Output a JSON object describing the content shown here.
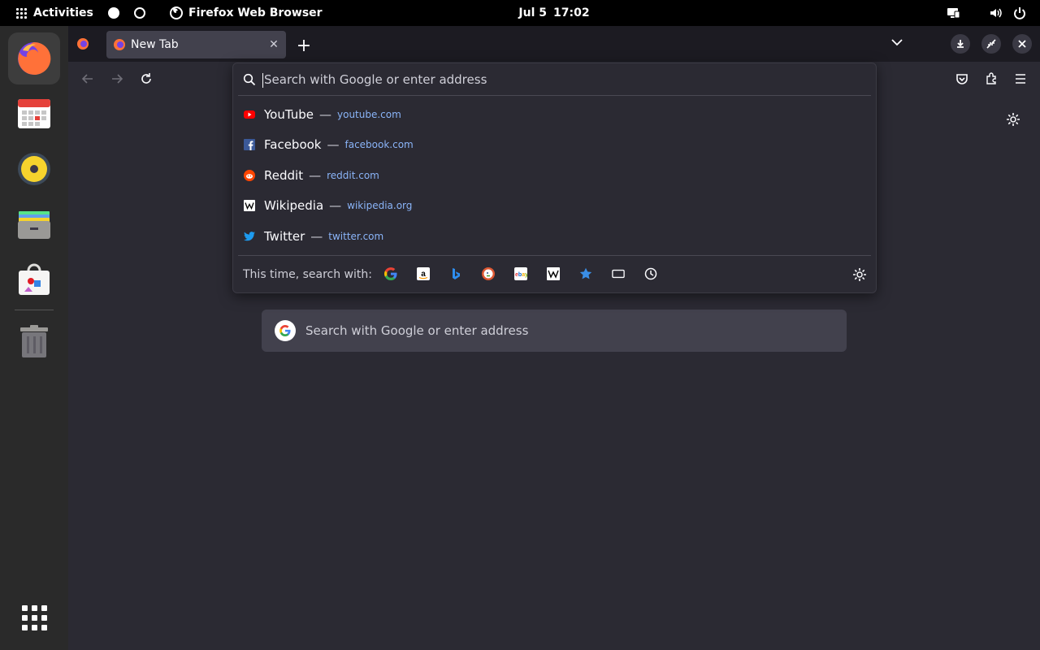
{
  "topbar": {
    "activities": "Activities",
    "app_name": "Firefox Web Browser",
    "date": "Jul 5",
    "time": "17:02"
  },
  "dock": {
    "items": [
      "Firefox",
      "Calendar",
      "Rhythmbox",
      "Files",
      "Software",
      "Trash",
      "Show Applications"
    ]
  },
  "tabs": {
    "active_title": "New Tab",
    "close": "✕",
    "new_tab": "+"
  },
  "urlbar": {
    "placeholder": "Search with Google or enter address",
    "suggestions": [
      {
        "title": "YouTube",
        "url": "youtube.com"
      },
      {
        "title": "Facebook",
        "url": "facebook.com"
      },
      {
        "title": "Reddit",
        "url": "reddit.com"
      },
      {
        "title": "Wikipedia",
        "url": "wikipedia.org"
      },
      {
        "title": "Twitter",
        "url": "twitter.com"
      }
    ],
    "separator": "—",
    "oneoff_label": "This time, search with:",
    "engines": [
      "Google",
      "Amazon",
      "Bing",
      "DuckDuckGo",
      "eBay",
      "Wikipedia",
      "Bookmarks",
      "Tabs",
      "History"
    ]
  },
  "newtab": {
    "search_placeholder": "Search with Google or enter address"
  },
  "colors": {
    "accent": "#8ab4f8",
    "chrome_bg": "#1c1b22",
    "toolbar_bg": "#2b2a33",
    "tab_bg": "#42414d"
  }
}
